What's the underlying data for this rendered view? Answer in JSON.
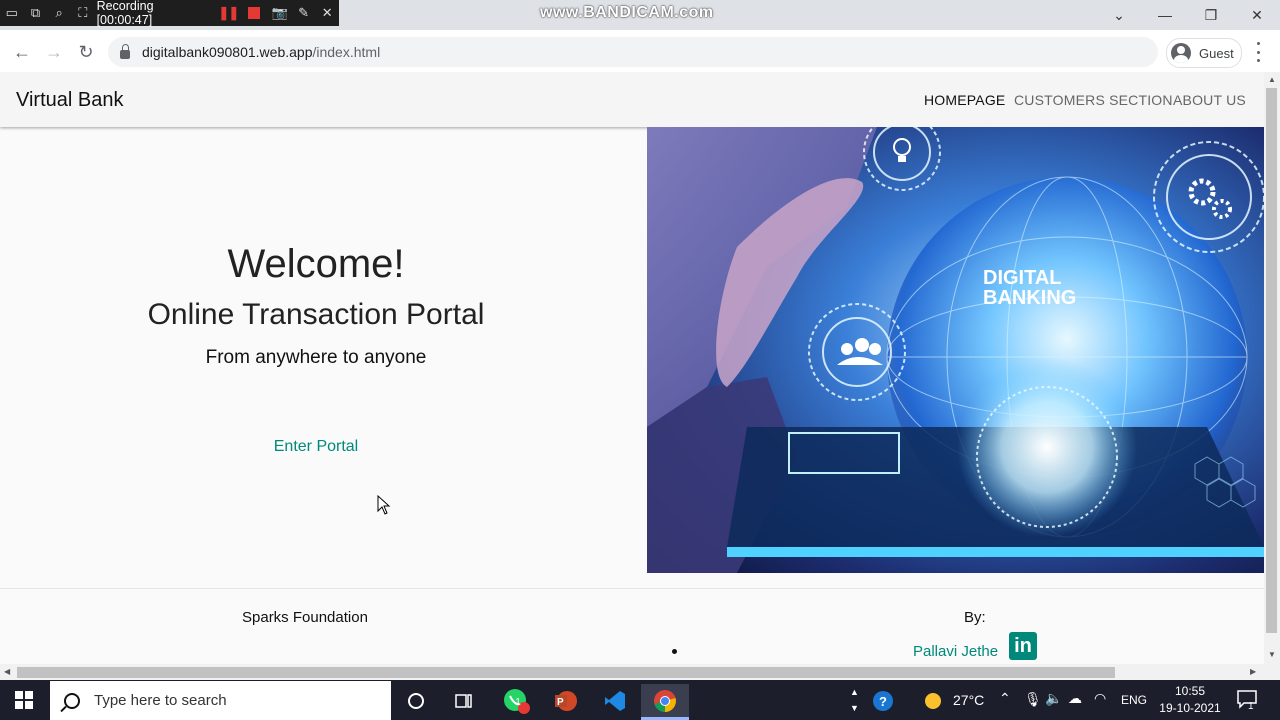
{
  "recorder": {
    "label": "Recording [00:00:47]",
    "watermark": "www.BANDICAM.com"
  },
  "browser": {
    "url_domain": "digitalbank090801.web.app",
    "url_path": "/index.html",
    "profile_label": "Guest"
  },
  "site": {
    "brand": "Virtual Bank",
    "nav": [
      {
        "label": "HOMEPAGE",
        "active": true
      },
      {
        "label": "CUSTOMERS SECTION",
        "active": false
      },
      {
        "label": "ABOUT US",
        "active": false
      }
    ],
    "hero": {
      "heading": "Welcome!",
      "subheading": "Online Transaction Portal",
      "tagline": "From anywhere to anyone",
      "cta": "Enter Portal",
      "image_text": "DIGITAL BANKING"
    },
    "footer": {
      "left_title": "Sparks Foundation",
      "by_label": "By:",
      "author": "Pallavi Jethe",
      "linkedin_text": "in"
    }
  },
  "taskbar": {
    "search_placeholder": "Type here to search",
    "whatsapp_badge": "1",
    "temperature": "27°C",
    "language": "ENG",
    "time": "10:55",
    "date": "19-10-2021",
    "notification_count": "1"
  },
  "colors": {
    "accent_teal": "#00897b",
    "navbar_bg": "#f5f5f5",
    "taskbar_bg": "#1c1f2b"
  }
}
